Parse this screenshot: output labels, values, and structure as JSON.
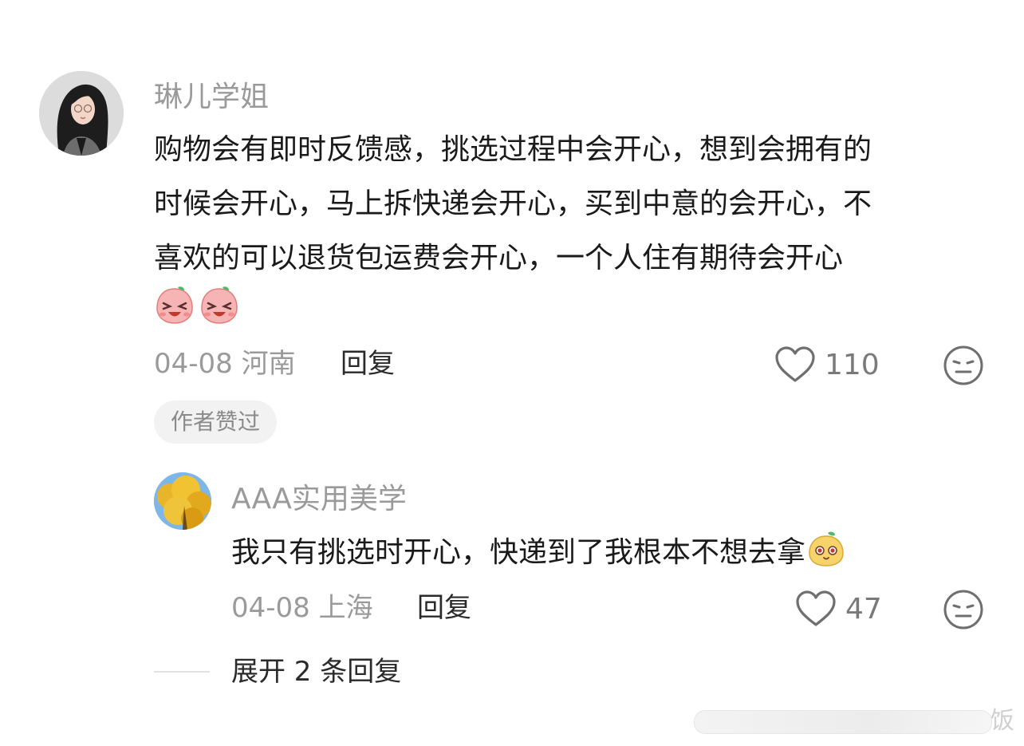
{
  "comment": {
    "username": "琳儿学姐",
    "text_lines": [
      "购物会有即时反馈感，挑选过程中会开心，想到会拥有的",
      "时候会开心，马上拆快递会开心，买到中意的会开心，不",
      "喜欢的可以退货包运费会开心，一个人住有期待会开心"
    ],
    "date": "04-08",
    "location": "河南",
    "reply_label": "回复",
    "like_count": "110",
    "author_badge": "作者赞过"
  },
  "reply": {
    "username": "AAA实用美学",
    "text": "我只有挑选时开心，快递到了我根本不想去拿",
    "date": "04-08",
    "location": "上海",
    "reply_label": "回复",
    "like_count": "47"
  },
  "expand": {
    "label": "展开 2 条回复"
  },
  "watermark": {
    "text": "饭"
  },
  "icons": {
    "like": "heart-icon",
    "reaction": "neutral-face-icon",
    "emoji_laugh": "laughing-peach-emoji",
    "emoji_smirk": "smirk-bun-emoji"
  },
  "colors": {
    "username": "#9a9a9a",
    "text": "#1a1a1a",
    "meta": "#9a9a9a",
    "badge_bg": "#f2f2f2"
  }
}
